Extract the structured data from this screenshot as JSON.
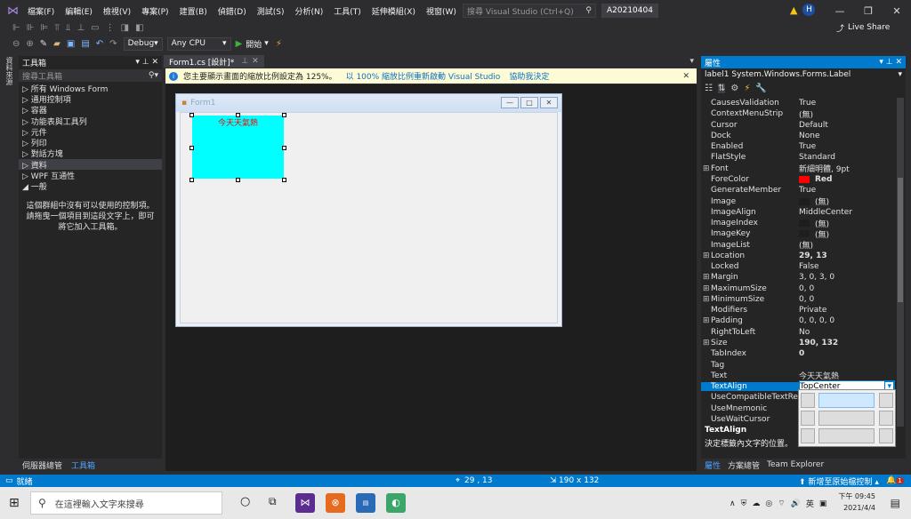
{
  "titlebar": {
    "menus": [
      "檔案(F)",
      "編輯(E)",
      "檢視(V)",
      "專案(P)",
      "建置(B)",
      "偵錯(D)",
      "測試(S)",
      "分析(N)",
      "工具(T)",
      "延伸模組(X)",
      "視窗(W)",
      "說明(H)"
    ],
    "search_placeholder": "搜尋 Visual Studio (Ctrl+Q)",
    "solution_name": "A20210404",
    "user_initial": "H",
    "live_share": "Live Share"
  },
  "toolbar": {
    "config": "Debug",
    "platform": "Any CPU",
    "start": "開始"
  },
  "left_strip": {
    "label": "資料來源"
  },
  "toolbox": {
    "title": "工具箱",
    "search_placeholder": "搜尋工具箱",
    "items": [
      {
        "label": "▷ 所有 Windows Form",
        "selected": false
      },
      {
        "label": "▷ 通用控制項",
        "selected": false
      },
      {
        "label": "▷ 容器",
        "selected": false
      },
      {
        "label": "▷ 功能表與工具列",
        "selected": false
      },
      {
        "label": "▷ 元件",
        "selected": false
      },
      {
        "label": "▷ 列印",
        "selected": false
      },
      {
        "label": "▷ 對話方塊",
        "selected": false
      },
      {
        "label": "▷ 資料",
        "selected": true
      },
      {
        "label": "▷ WPF 互通性",
        "selected": false
      },
      {
        "label": "◢ 一般",
        "selected": false
      }
    ],
    "empty_note": "這個群組中沒有可以使用的控制項。請拖曳一個項目到這段文字上，即可將它加入工具箱。",
    "tabs": [
      "伺服器總管",
      "工具箱"
    ]
  },
  "document": {
    "tab_label": "Form1.cs [設計]*",
    "info_text": "您主要顯示畫面的縮放比例設定為 125%。",
    "info_link1": "以 100% 縮放比例重新啟動 Visual Studio",
    "info_link2": "協助我決定",
    "form_title": "Form1",
    "label_text": "今天天氣熱"
  },
  "properties": {
    "title": "屬性",
    "object": "label1  System.Windows.Forms.Label",
    "rows": [
      {
        "name": "CausesValidation",
        "value": "True"
      },
      {
        "name": "ContextMenuStrip",
        "value": "(無)"
      },
      {
        "name": "Cursor",
        "value": "Default"
      },
      {
        "name": "Dock",
        "value": "None"
      },
      {
        "name": "Enabled",
        "value": "True"
      },
      {
        "name": "FlatStyle",
        "value": "Standard"
      },
      {
        "name": "Font",
        "value": "新細明體, 9pt",
        "expand": true
      },
      {
        "name": "ForeColor",
        "value": "Red",
        "swatch": "#ff0000",
        "bold": true
      },
      {
        "name": "GenerateMember",
        "value": "True"
      },
      {
        "name": "Image",
        "value": "(無)",
        "swatch": "#1e1e1e"
      },
      {
        "name": "ImageAlign",
        "value": "MiddleCenter"
      },
      {
        "name": "ImageIndex",
        "value": "(無)",
        "swatch": "#1e1e1e"
      },
      {
        "name": "ImageKey",
        "value": "(無)",
        "swatch": "#1e1e1e"
      },
      {
        "name": "ImageList",
        "value": "(無)"
      },
      {
        "name": "Location",
        "value": "29, 13",
        "expand": true,
        "bold": true
      },
      {
        "name": "Locked",
        "value": "False"
      },
      {
        "name": "Margin",
        "value": "3, 0, 3, 0",
        "expand": true
      },
      {
        "name": "MaximumSize",
        "value": "0, 0",
        "expand": true
      },
      {
        "name": "MinimumSize",
        "value": "0, 0",
        "expand": true
      },
      {
        "name": "Modifiers",
        "value": "Private"
      },
      {
        "name": "Padding",
        "value": "0, 0, 0, 0",
        "expand": true
      },
      {
        "name": "RightToLeft",
        "value": "No"
      },
      {
        "name": "Size",
        "value": "190, 132",
        "expand": true,
        "bold": true
      },
      {
        "name": "TabIndex",
        "value": "0",
        "bold": true
      },
      {
        "name": "Tag",
        "value": ""
      },
      {
        "name": "Text",
        "value": "今天天氣熱"
      },
      {
        "name": "TextAlign",
        "value": "TopCenter",
        "selected": true
      },
      {
        "name": "UseCompatibleTextRendering",
        "value": ""
      },
      {
        "name": "UseMnemonic",
        "value": ""
      },
      {
        "name": "UseWaitCursor",
        "value": ""
      }
    ],
    "desc_title": "TextAlign",
    "desc_text": "決定標籤內文字的位置。",
    "tabs": [
      "屬性",
      "方案總管",
      "Team Explorer"
    ]
  },
  "statusbar": {
    "ready": "就緒",
    "position": "29 , 13",
    "size": "190 x 132",
    "source_control": "新增至原始檔控制",
    "notifications": "1"
  },
  "taskbar": {
    "search_placeholder": "在這裡輸入文字來搜尋",
    "ime": "英",
    "time": "下午 09:45",
    "date": "2021/4/4"
  }
}
